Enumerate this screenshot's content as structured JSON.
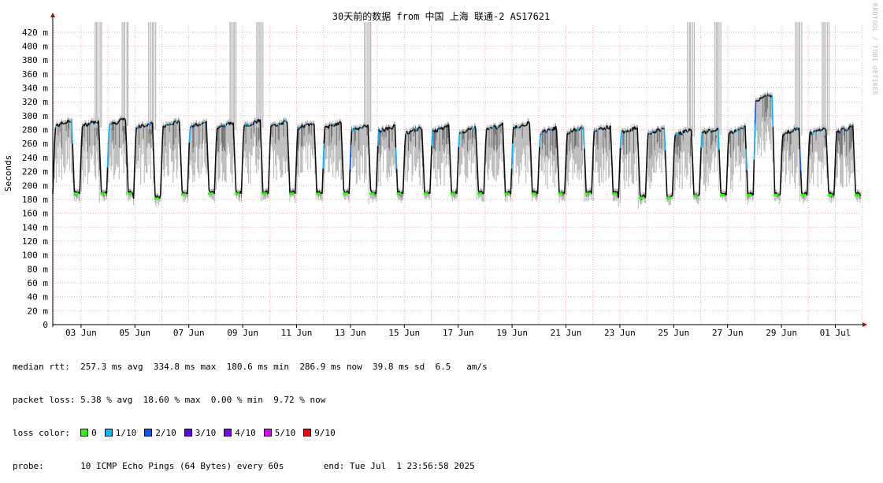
{
  "chart_data": {
    "type": "line",
    "title": "30天前的数据 from 中国 上海 联通-2 AS17621",
    "ylabel": "Seconds",
    "y_ticks": [
      "0",
      "20 m",
      "40 m",
      "60 m",
      "80 m",
      "100 m",
      "120 m",
      "140 m",
      "160 m",
      "180 m",
      "200 m",
      "220 m",
      "240 m",
      "260 m",
      "280 m",
      "300 m",
      "320 m",
      "340 m",
      "360 m",
      "380 m",
      "400 m",
      "420 m"
    ],
    "ylim": [
      0,
      430
    ],
    "x_ticks": [
      "03 Jun",
      "05 Jun",
      "07 Jun",
      "09 Jun",
      "11 Jun",
      "13 Jun",
      "15 Jun",
      "17 Jun",
      "19 Jun",
      "21 Jun",
      "23 Jun",
      "25 Jun",
      "27 Jun",
      "29 Jun",
      "01 Jul"
    ],
    "xlim_days": [
      "2025-06-01T23:56:58",
      "2025-07-01T23:56:58"
    ],
    "grid": true,
    "daily_low_ms": [
      188,
      188,
      188,
      181,
      187,
      188,
      188,
      188,
      188,
      188,
      188,
      188,
      188,
      188,
      188,
      188,
      188,
      188,
      188,
      188,
      188,
      182,
      182,
      185,
      186,
      186,
      186,
      186,
      186,
      186
    ],
    "daily_high_ms": [
      293,
      293,
      295,
      290,
      292,
      292,
      290,
      293,
      292,
      290,
      290,
      287,
      285,
      283,
      285,
      283,
      287,
      290,
      283,
      283,
      285,
      283,
      282,
      280,
      282,
      283,
      330,
      282,
      282,
      284
    ],
    "loss_spike_days": [
      1,
      2,
      3,
      6,
      7,
      11,
      23,
      24,
      27,
      28
    ]
  },
  "stats": {
    "rtt_label": "median rtt:",
    "rtt_avg": "257.3 ms avg",
    "rtt_max": "334.8 ms max",
    "rtt_min": "180.6 ms min",
    "rtt_now": "286.9 ms now",
    "rtt_sd": "39.8 ms sd",
    "rtt_ams": "6.5   am/s",
    "loss_label": "packet loss:",
    "loss_avg": "5.38 % avg",
    "loss_max": "18.60 % max",
    "loss_min": "0.00 % min",
    "loss_now": "9.72 % now",
    "color_label": "loss color:",
    "loss_colors": [
      {
        "label": "0",
        "color": "#26ff00"
      },
      {
        "label": "1/10",
        "color": "#00b8ff"
      },
      {
        "label": "2/10",
        "color": "#0059ff"
      },
      {
        "label": "3/10",
        "color": "#5e00ff"
      },
      {
        "label": "4/10",
        "color": "#7e00ff"
      },
      {
        "label": "5/10",
        "color": "#dd00ff"
      },
      {
        "label": "9/10",
        "color": "#ff0000"
      }
    ],
    "probe_label": "probe:",
    "probe_value": "10 ICMP Echo Pings (64 Bytes) every 60s",
    "end": "end: Tue Jul  1 23:56:58 2025"
  },
  "watermark": "RRDTOOL / TOBI OETIKER"
}
